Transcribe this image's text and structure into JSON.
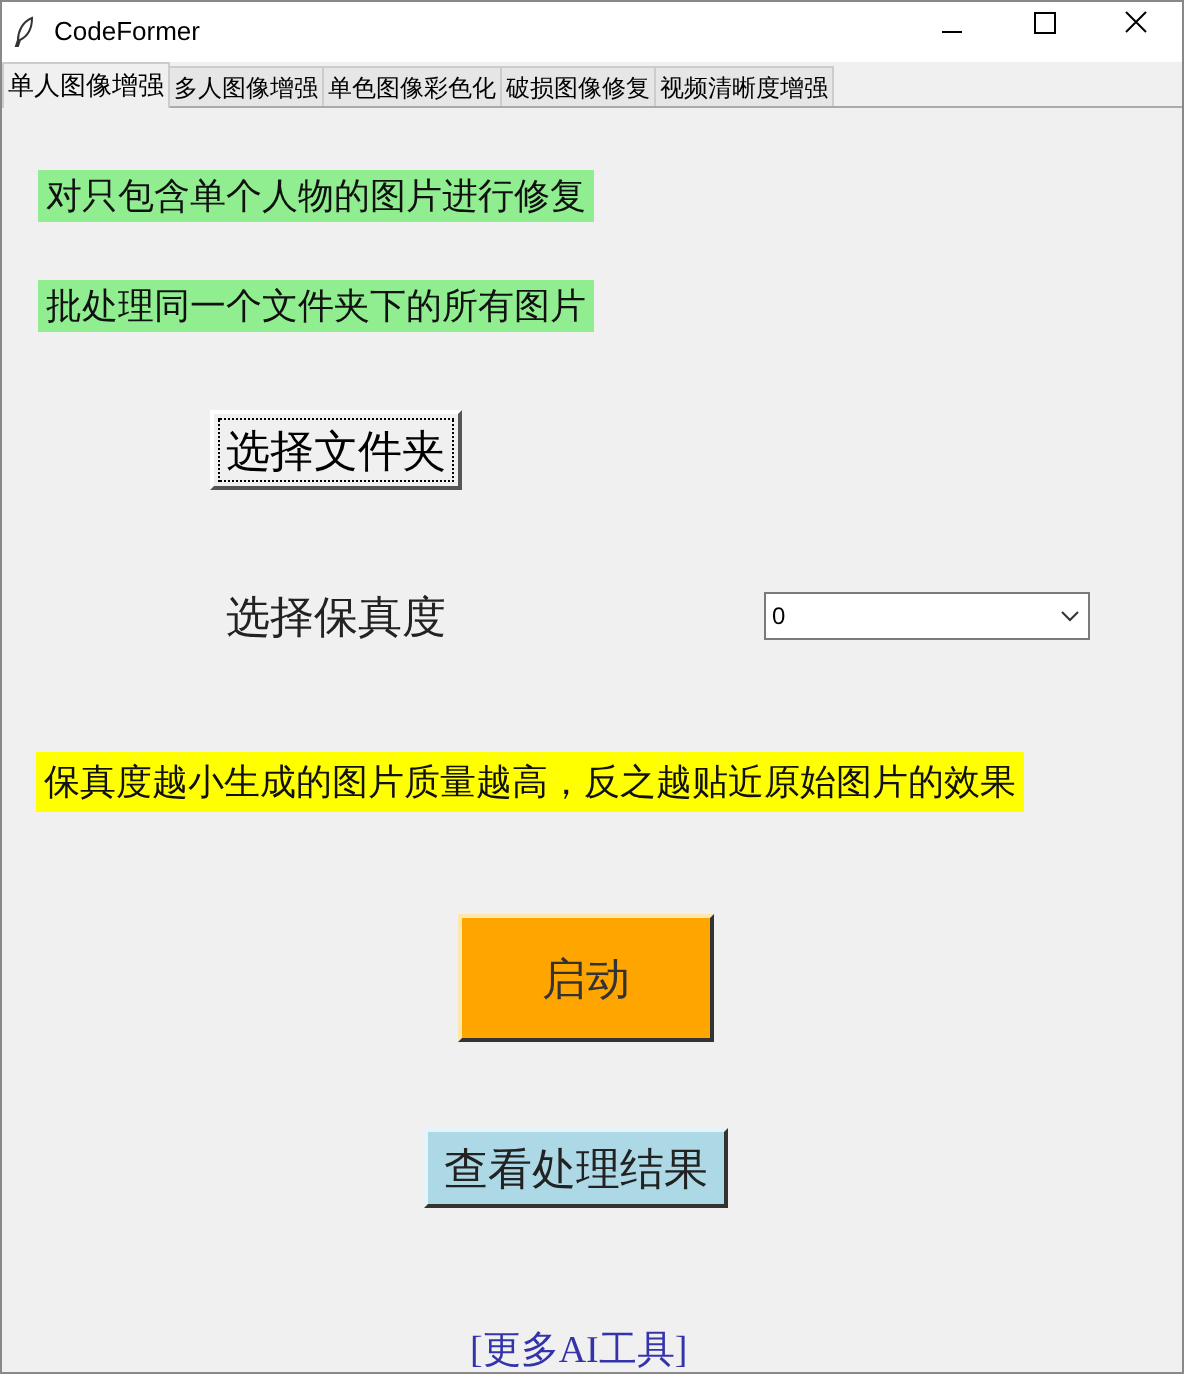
{
  "window": {
    "title": "CodeFormer"
  },
  "tabs": [
    {
      "label": "单人图像增强",
      "selected": true
    },
    {
      "label": "多人图像增强",
      "selected": false
    },
    {
      "label": "单色图像彩色化",
      "selected": false
    },
    {
      "label": "破损图像修复",
      "selected": false
    },
    {
      "label": "视频清晰度增强",
      "selected": false
    }
  ],
  "labels": [
    "对只包含单个人物的图片进行修复",
    "批处理同一个文件夹下的所有图片"
  ],
  "folder_button": "选择文件夹",
  "fidelity": {
    "label": "选择保真度",
    "value": "0"
  },
  "hint": "保真度越小生成的图片质量越高，反之越贴近原始图片的效果",
  "start_button": "启动",
  "results_button": "查看处理结果",
  "link": "[更多AI工具]"
}
